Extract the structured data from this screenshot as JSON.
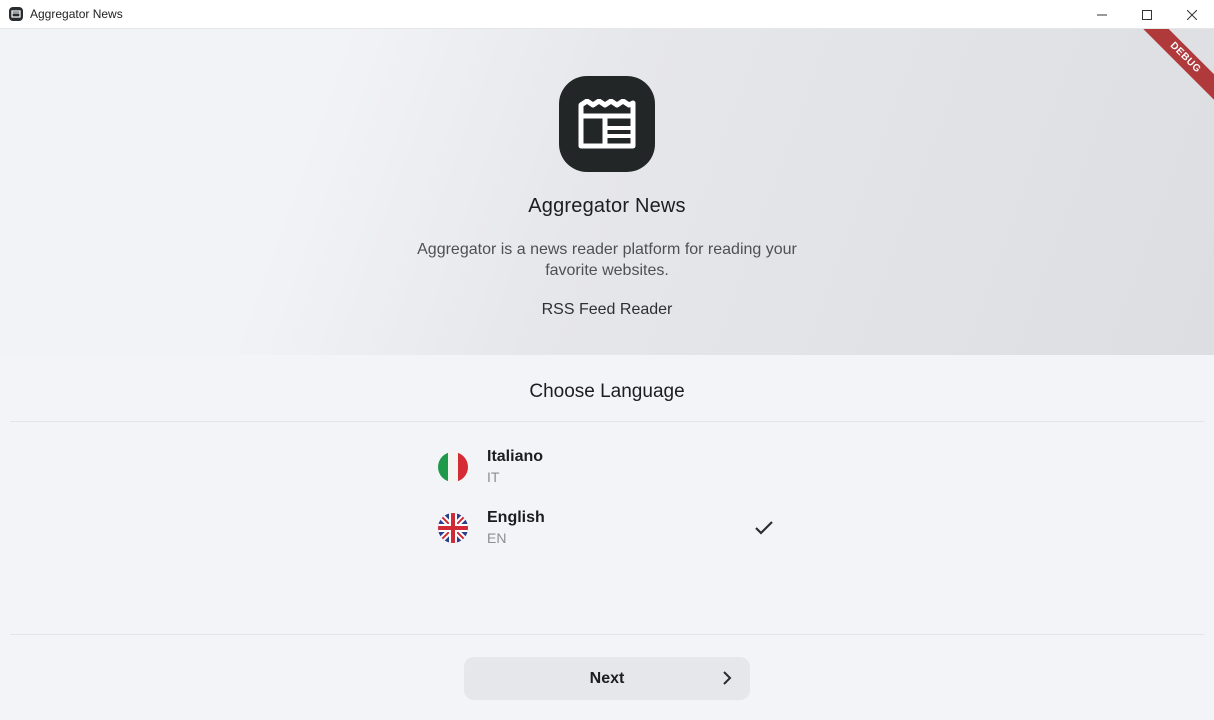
{
  "window": {
    "title": "Aggregator News",
    "controls": [
      "minimize-icon",
      "maximize-icon",
      "close-icon"
    ]
  },
  "debug_banner": "DEBUG",
  "hero": {
    "app_name": "Aggregator News",
    "description": "Aggregator is a news reader platform for reading your favorite websites.",
    "tagline": "RSS Feed Reader",
    "logo_icon": "newspaper-icon"
  },
  "language": {
    "title": "Choose Language",
    "items": [
      {
        "name": "Italiano",
        "code": "IT",
        "flag": "italy-flag-icon",
        "selected": false
      },
      {
        "name": "English",
        "code": "EN",
        "flag": "uk-flag-icon",
        "selected": true
      }
    ]
  },
  "actions": {
    "next_label": "Next"
  },
  "colors": {
    "logo_bg": "#222627",
    "ribbon": "#b0393b",
    "button_bg": "#e6e7ea"
  }
}
